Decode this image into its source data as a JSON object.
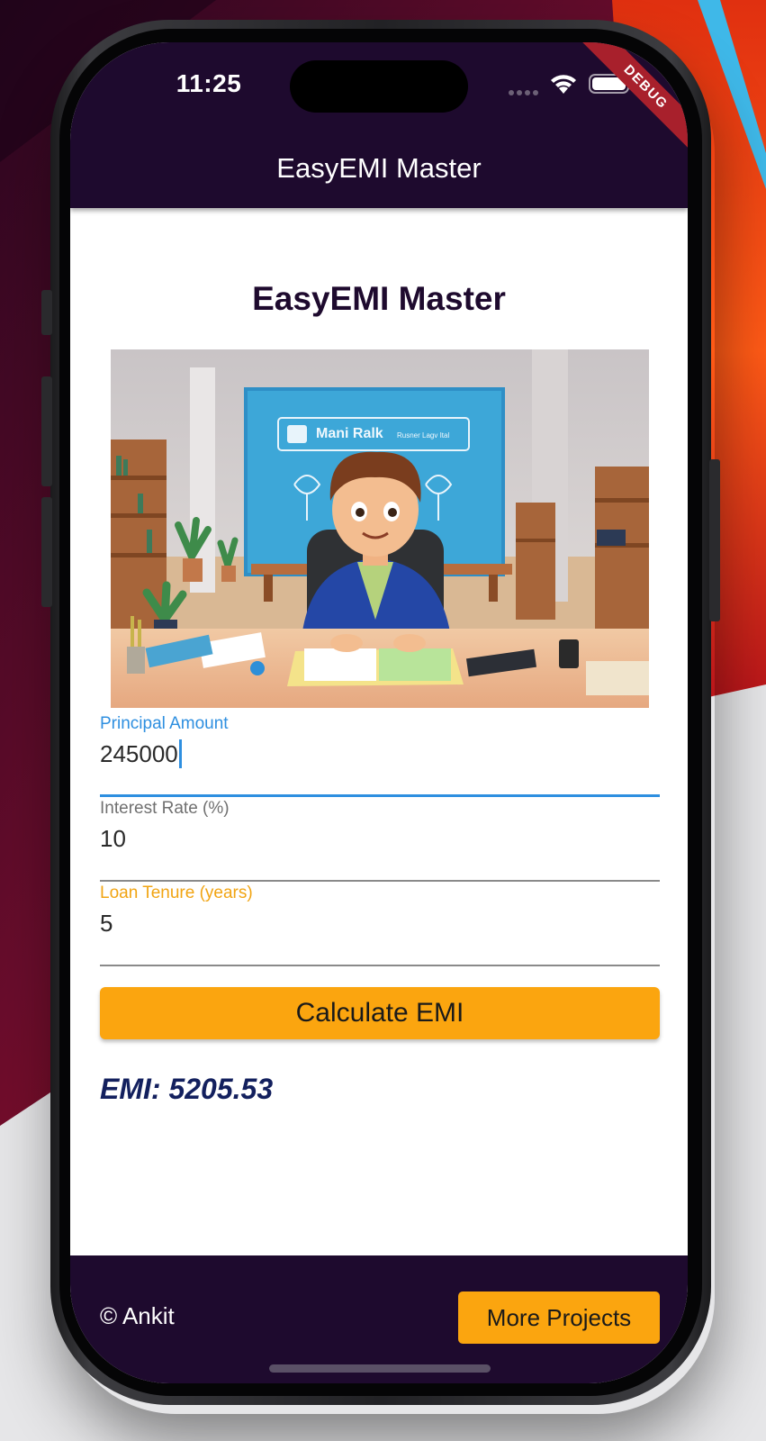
{
  "status_bar": {
    "time": "11:25",
    "debug_banner": "DEBUG"
  },
  "app_bar": {
    "title": "EasyEMI Master"
  },
  "main": {
    "title": "EasyEMI Master",
    "hero_image": {
      "sign_text": "Mani Ralk",
      "sign_subtext": "Rusner Lagv Ital"
    },
    "fields": [
      {
        "label": "Principal Amount",
        "value": "245000",
        "state": "focused"
      },
      {
        "label": "Interest Rate (%)",
        "value": "10",
        "state": "normal"
      },
      {
        "label": "Loan Tenure (years)",
        "value": "5",
        "state": "normal"
      }
    ],
    "calculate_label": "Calculate EMI",
    "result": "EMI: 5205.53"
  },
  "footer": {
    "copyright": "© Ankit",
    "more_label": "More Projects"
  },
  "colors": {
    "app_bar": "#1e0a2e",
    "accent_orange": "#fba50f",
    "focus_blue": "#2e8fe0",
    "result_navy": "#13205e",
    "debug_red": "#a8202c"
  },
  "icons": [
    "signal-icon",
    "wifi-icon",
    "battery-icon"
  ]
}
